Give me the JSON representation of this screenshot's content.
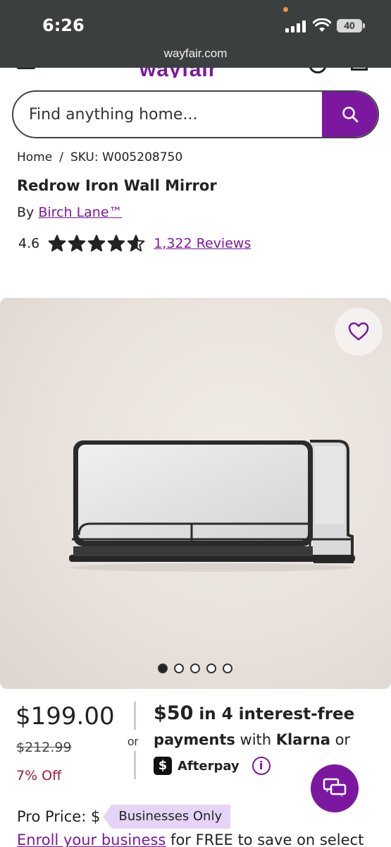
{
  "status_bar": {
    "time": "6:26",
    "battery": "40",
    "url": "wayfair.com"
  },
  "header": {
    "logo": "wayfair"
  },
  "search": {
    "placeholder": "Find anything home..."
  },
  "breadcrumb": {
    "home": "Home",
    "separator": "/",
    "sku": "SKU: W005208750"
  },
  "product": {
    "title": "Redrow Iron Wall Mirror",
    "by_prefix": "By",
    "brand": "Birch Lane™",
    "rating": "4.6",
    "rating_value": 4.6,
    "reviews": "1,322 Reviews",
    "image_count": 5,
    "active_image": 1
  },
  "pricing": {
    "price": "$199.00",
    "old_price": "$212.99",
    "discount": "7% Off",
    "or": "or",
    "klarna_amount": "$50",
    "klarna_text1": " in 4 interest-free",
    "klarna_text2a": "payments",
    "klarna_text2b": " with ",
    "klarna_brand": "Klarna",
    "klarna_text2c": " or",
    "afterpay_badge": "$",
    "afterpay_label": "Afterpay",
    "info": "i"
  },
  "pro": {
    "label": "Pro Price: $",
    "tag": "Businesses Only",
    "enroll_link": "Enroll your business",
    "enroll_rest": " for FREE to save on select"
  },
  "colors": {
    "brand": "#7b189f",
    "discount": "#a11c2e"
  }
}
